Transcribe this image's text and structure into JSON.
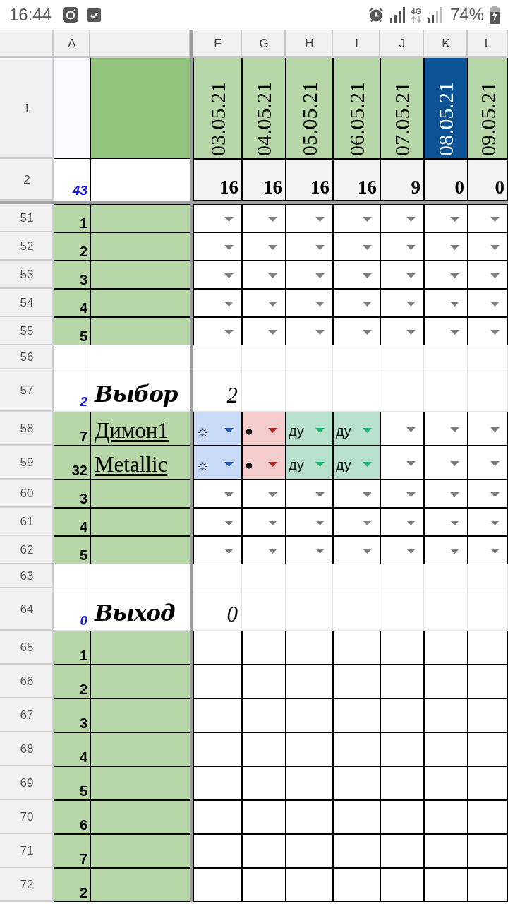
{
  "status_bar": {
    "time": "16:44",
    "network": "4G",
    "battery": "74%"
  },
  "column_headers": {
    "frozen": [
      "A"
    ],
    "scrolling": [
      "F",
      "G",
      "H",
      "I",
      "J",
      "K",
      "L"
    ]
  },
  "frozen_rows": [
    {
      "number": "1",
      "kind": "dates",
      "cells": [
        {
          "text": "03.05.21",
          "selected": false
        },
        {
          "text": "04.05.21",
          "selected": false
        },
        {
          "text": "05.05.21",
          "selected": false
        },
        {
          "text": "06.05.21",
          "selected": false
        },
        {
          "text": "07.05.21",
          "selected": false
        },
        {
          "text": "08.05.21",
          "selected": true
        },
        {
          "text": "09.05.21",
          "selected": false
        }
      ]
    },
    {
      "number": "2",
      "kind": "totals",
      "count": "43",
      "cells": [
        "16",
        "16",
        "16",
        "16",
        "9",
        "0",
        "0"
      ]
    }
  ],
  "rows": [
    {
      "number": "51",
      "kind": "entry",
      "index": "1",
      "cells": [
        {
          "kind": "dropdown"
        },
        {
          "kind": "dropdown"
        },
        {
          "kind": "dropdown"
        },
        {
          "kind": "dropdown"
        },
        {
          "kind": "dropdown"
        },
        {
          "kind": "dropdown"
        },
        {
          "kind": "dropdown"
        }
      ]
    },
    {
      "number": "52",
      "kind": "entry",
      "index": "2",
      "cells": [
        {
          "kind": "dropdown"
        },
        {
          "kind": "dropdown"
        },
        {
          "kind": "dropdown"
        },
        {
          "kind": "dropdown"
        },
        {
          "kind": "dropdown"
        },
        {
          "kind": "dropdown"
        },
        {
          "kind": "dropdown"
        }
      ]
    },
    {
      "number": "53",
      "kind": "entry",
      "index": "3",
      "cells": [
        {
          "kind": "dropdown"
        },
        {
          "kind": "dropdown"
        },
        {
          "kind": "dropdown"
        },
        {
          "kind": "dropdown"
        },
        {
          "kind": "dropdown"
        },
        {
          "kind": "dropdown"
        },
        {
          "kind": "dropdown"
        }
      ]
    },
    {
      "number": "54",
      "kind": "entry",
      "index": "4",
      "cells": [
        {
          "kind": "dropdown"
        },
        {
          "kind": "dropdown"
        },
        {
          "kind": "dropdown"
        },
        {
          "kind": "dropdown"
        },
        {
          "kind": "dropdown"
        },
        {
          "kind": "dropdown"
        },
        {
          "kind": "dropdown"
        }
      ]
    },
    {
      "number": "55",
      "kind": "entry",
      "index": "5",
      "cells": [
        {
          "kind": "dropdown"
        },
        {
          "kind": "dropdown"
        },
        {
          "kind": "dropdown"
        },
        {
          "kind": "dropdown"
        },
        {
          "kind": "dropdown"
        },
        {
          "kind": "dropdown"
        },
        {
          "kind": "dropdown"
        }
      ]
    },
    {
      "number": "56",
      "kind": "blank"
    },
    {
      "number": "57",
      "kind": "section",
      "count": "2",
      "title": "Выбор",
      "total": "2"
    },
    {
      "number": "58",
      "kind": "entry",
      "index": "7",
      "name": "Димон1",
      "cells": [
        {
          "kind": "chip",
          "text": "☼",
          "color": "#c9daf8"
        },
        {
          "kind": "chip",
          "text": "●",
          "color": "#f4cccc"
        },
        {
          "kind": "chip",
          "text": "ду",
          "color": "#b7e1cd"
        },
        {
          "kind": "chip",
          "text": "ду",
          "color": "#b7e1cd"
        },
        {
          "kind": "dropdown"
        },
        {
          "kind": "dropdown"
        },
        {
          "kind": "dropdown"
        }
      ]
    },
    {
      "number": "59",
      "kind": "entry",
      "index": "32",
      "name": "Metallic",
      "cells": [
        {
          "kind": "chip",
          "text": "☼",
          "color": "#c9daf8"
        },
        {
          "kind": "chip",
          "text": "●",
          "color": "#f4cccc"
        },
        {
          "kind": "chip",
          "text": "ду",
          "color": "#b7e1cd"
        },
        {
          "kind": "chip",
          "text": "ду",
          "color": "#b7e1cd"
        },
        {
          "kind": "dropdown"
        },
        {
          "kind": "dropdown"
        },
        {
          "kind": "dropdown"
        }
      ]
    },
    {
      "number": "60",
      "kind": "entry",
      "index": "3",
      "cells": [
        {
          "kind": "dropdown"
        },
        {
          "kind": "dropdown"
        },
        {
          "kind": "dropdown"
        },
        {
          "kind": "dropdown"
        },
        {
          "kind": "dropdown"
        },
        {
          "kind": "dropdown"
        },
        {
          "kind": "dropdown"
        }
      ]
    },
    {
      "number": "61",
      "kind": "entry",
      "index": "4",
      "cells": [
        {
          "kind": "dropdown"
        },
        {
          "kind": "dropdown"
        },
        {
          "kind": "dropdown"
        },
        {
          "kind": "dropdown"
        },
        {
          "kind": "dropdown"
        },
        {
          "kind": "dropdown"
        },
        {
          "kind": "dropdown"
        }
      ]
    },
    {
      "number": "62",
      "kind": "entry",
      "index": "5",
      "cells": [
        {
          "kind": "dropdown"
        },
        {
          "kind": "dropdown"
        },
        {
          "kind": "dropdown"
        },
        {
          "kind": "dropdown"
        },
        {
          "kind": "dropdown"
        },
        {
          "kind": "dropdown"
        },
        {
          "kind": "dropdown"
        }
      ]
    },
    {
      "number": "63",
      "kind": "blank"
    },
    {
      "number": "64",
      "kind": "section",
      "count": "0",
      "title": "Выход",
      "total": "0"
    },
    {
      "number": "65",
      "kind": "entry",
      "index": "1",
      "cells": [
        {
          "kind": "plain"
        },
        {
          "kind": "plain"
        },
        {
          "kind": "plain"
        },
        {
          "kind": "plain"
        },
        {
          "kind": "plain"
        },
        {
          "kind": "plain"
        },
        {
          "kind": "plain"
        }
      ]
    },
    {
      "number": "66",
      "kind": "entry",
      "index": "2",
      "cells": [
        {
          "kind": "plain"
        },
        {
          "kind": "plain"
        },
        {
          "kind": "plain"
        },
        {
          "kind": "plain"
        },
        {
          "kind": "plain"
        },
        {
          "kind": "plain"
        },
        {
          "kind": "plain"
        }
      ]
    },
    {
      "number": "67",
      "kind": "entry",
      "index": "3",
      "cells": [
        {
          "kind": "plain"
        },
        {
          "kind": "plain"
        },
        {
          "kind": "plain"
        },
        {
          "kind": "plain"
        },
        {
          "kind": "plain"
        },
        {
          "kind": "plain"
        },
        {
          "kind": "plain"
        }
      ]
    },
    {
      "number": "68",
      "kind": "entry",
      "index": "4",
      "cells": [
        {
          "kind": "plain"
        },
        {
          "kind": "plain"
        },
        {
          "kind": "plain"
        },
        {
          "kind": "plain"
        },
        {
          "kind": "plain"
        },
        {
          "kind": "plain"
        },
        {
          "kind": "plain"
        }
      ]
    },
    {
      "number": "69",
      "kind": "entry",
      "index": "5",
      "cells": [
        {
          "kind": "plain"
        },
        {
          "kind": "plain"
        },
        {
          "kind": "plain"
        },
        {
          "kind": "plain"
        },
        {
          "kind": "plain"
        },
        {
          "kind": "plain"
        },
        {
          "kind": "plain"
        }
      ]
    },
    {
      "number": "70",
      "kind": "entry",
      "index": "6",
      "cells": [
        {
          "kind": "plain"
        },
        {
          "kind": "plain"
        },
        {
          "kind": "plain"
        },
        {
          "kind": "plain"
        },
        {
          "kind": "plain"
        },
        {
          "kind": "plain"
        },
        {
          "kind": "plain"
        }
      ]
    },
    {
      "number": "71",
      "kind": "entry",
      "index": "7",
      "cells": [
        {
          "kind": "plain"
        },
        {
          "kind": "plain"
        },
        {
          "kind": "plain"
        },
        {
          "kind": "plain"
        },
        {
          "kind": "plain"
        },
        {
          "kind": "plain"
        },
        {
          "kind": "plain"
        }
      ]
    },
    {
      "number": "72",
      "kind": "entry",
      "index": "2",
      "cells": [
        {
          "kind": "plain"
        },
        {
          "kind": "plain"
        },
        {
          "kind": "plain"
        },
        {
          "kind": "plain"
        },
        {
          "kind": "plain"
        },
        {
          "kind": "plain"
        },
        {
          "kind": "plain"
        }
      ]
    }
  ]
}
